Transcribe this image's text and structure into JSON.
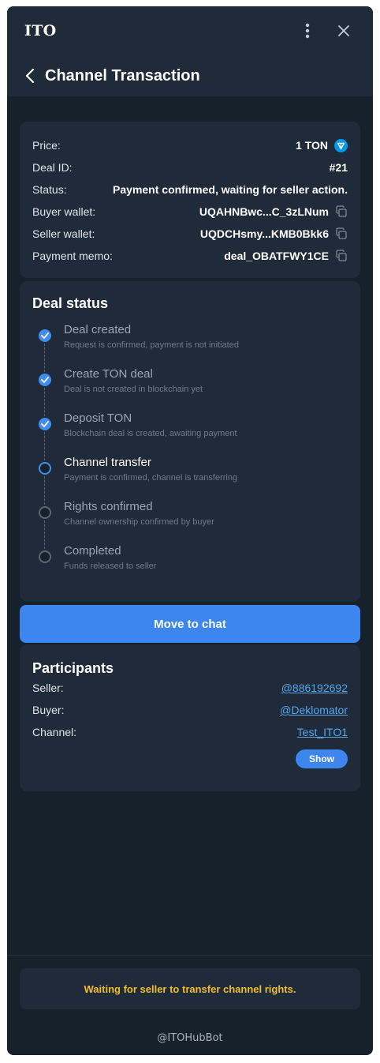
{
  "titlebar": {
    "title": "ITO"
  },
  "header": {
    "title": "Channel Transaction"
  },
  "info": {
    "price_label": "Price:",
    "price_value": "1 TON",
    "deal_id_label": "Deal ID:",
    "deal_id_value": "#21",
    "status_label": "Status:",
    "status_value": "Payment confirmed, waiting for seller action.",
    "buyer_wallet_label": "Buyer wallet:",
    "buyer_wallet_value": "UQAHNBwc...C_3zLNum",
    "seller_wallet_label": "Seller wallet:",
    "seller_wallet_value": "UQDCHsmy...KMB0Bkk6",
    "memo_label": "Payment memo:",
    "memo_value": "deal_OBATFWY1CE"
  },
  "deal_status": {
    "title": "Deal status",
    "steps": [
      {
        "title": "Deal created",
        "subtitle": "Request is confirmed, payment is not initiated",
        "state": "done"
      },
      {
        "title": "Create TON deal",
        "subtitle": "Deal is not created in blockchain yet",
        "state": "done"
      },
      {
        "title": "Deposit TON",
        "subtitle": "Blockchain deal is created, awaiting payment",
        "state": "done"
      },
      {
        "title": "Channel transfer",
        "subtitle": "Payment is confirmed, channel is transferring",
        "state": "active"
      },
      {
        "title": "Rights confirmed",
        "subtitle": "Channel ownership confirmed by buyer",
        "state": "pending"
      },
      {
        "title": "Completed",
        "subtitle": "Funds released to seller",
        "state": "pending"
      }
    ]
  },
  "actions": {
    "chat_label": "Move to chat"
  },
  "participants": {
    "title": "Participants",
    "seller_label": "Seller:",
    "seller_value": "@886192692",
    "buyer_label": "Buyer:",
    "buyer_value": "@Deklomator",
    "channel_label": "Channel:",
    "channel_value": "Test_ITO1",
    "show_label": "Show"
  },
  "footer": {
    "notice": "Waiting for seller to transfer channel rights.",
    "bot": "@ITOHubBot"
  },
  "colors": {
    "accent": "#3d86f0",
    "warning": "#f2bd27",
    "background": "#17212b",
    "card": "#1f2b38"
  }
}
